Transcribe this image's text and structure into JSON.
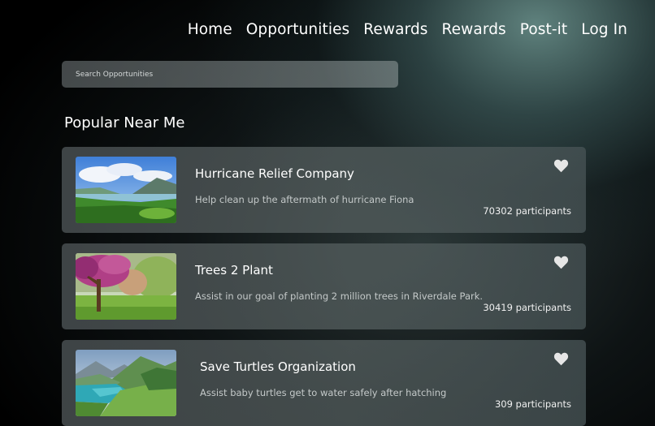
{
  "nav": {
    "items": [
      "Home",
      "Opportunities",
      "Rewards",
      "Rewards",
      "Post-it",
      "Log In"
    ]
  },
  "search": {
    "placeholder": "Search Opportunities"
  },
  "section": {
    "title": "Popular Near Me"
  },
  "cards": [
    {
      "title": "Hurricane Relief Company",
      "description": "Help clean up the aftermath of hurricane Fiona",
      "participants": "70302 participants",
      "icon": "heart-icon"
    },
    {
      "title": "Trees 2 Plant",
      "description": "Assist in our goal of planting 2 million trees in Riverdale Park.",
      "participants": "30419 participants",
      "icon": "heart-icon"
    },
    {
      "title": "Save Turtles Organization",
      "description": "Assist baby turtles get to water safely after hatching",
      "participants": "309 participants",
      "icon": "heart-icon"
    }
  ],
  "colors": {
    "card_background": "#4c5557",
    "description_text": "#c4c9c9",
    "heart": "#e6e6e6"
  }
}
